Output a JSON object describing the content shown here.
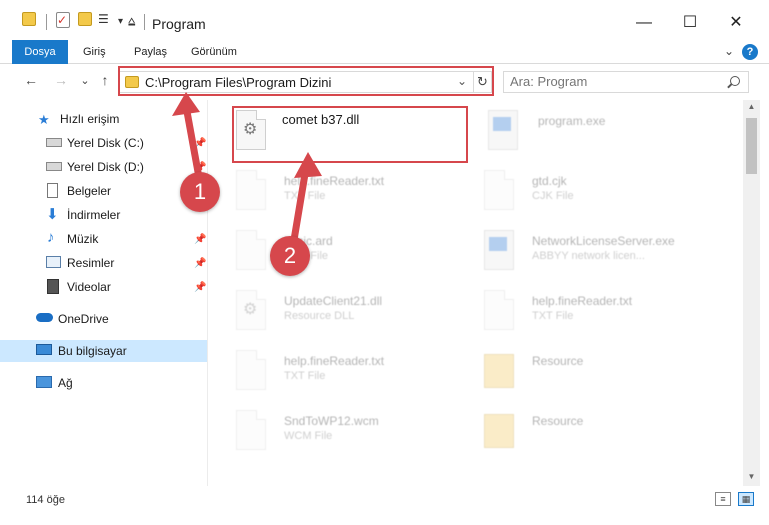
{
  "window": {
    "title": "Program",
    "minimize": "—",
    "maximize": "☐",
    "close": "✕"
  },
  "ribbon": {
    "tabs": [
      {
        "label": "Dosya"
      },
      {
        "label": "Giriş"
      },
      {
        "label": "Paylaş"
      },
      {
        "label": "Görünüm"
      }
    ],
    "expand": "⌄",
    "help": "?"
  },
  "nav": {
    "back": "←",
    "forward": "→",
    "recent": "⌄",
    "up": "↑",
    "address": "C:\\Program Files\\Program Dizini",
    "address_dropdown": "⌄",
    "refresh": "↻",
    "search_placeholder": "Ara: Program"
  },
  "sidebar": {
    "items": [
      {
        "label": "Hızlı erişim",
        "icon": "star-icon"
      },
      {
        "label": "Yerel Disk (C:)",
        "icon": "drive-icon"
      },
      {
        "label": "Yerel Disk (D:)",
        "icon": "drive-icon"
      },
      {
        "label": "Belgeler",
        "icon": "documents-icon"
      },
      {
        "label": "İndirmeler",
        "icon": "download-icon"
      },
      {
        "label": "Müzik",
        "icon": "music-icon"
      },
      {
        "label": "Resimler",
        "icon": "pictures-icon"
      },
      {
        "label": "Videolar",
        "icon": "video-icon"
      },
      {
        "label": "OneDrive",
        "icon": "cloud-icon"
      },
      {
        "label": "Bu bilgisayar",
        "icon": "computer-icon"
      },
      {
        "label": "Ağ",
        "icon": "network-icon"
      }
    ]
  },
  "files": [
    {
      "name": "comet b37.dll",
      "type": ""
    },
    {
      "name": "program.exe",
      "type": ""
    },
    {
      "name": "help.fineReader.txt",
      "type": "TXT File"
    },
    {
      "name": "gtd.cjk",
      "type": "CJK File"
    },
    {
      "name": "basic.ard",
      "type": "ARD File"
    },
    {
      "name": "NetworkLicenseServer.exe",
      "type": "ABBYY network licen..."
    },
    {
      "name": "UpdateClient21.dll",
      "type": "Resource DLL"
    },
    {
      "name": "help.fineReader.txt",
      "type": "TXT File"
    },
    {
      "name": "help.fineReader.txt",
      "type": "TXT File"
    },
    {
      "name": "Resource",
      "type": ""
    },
    {
      "name": "SndToWP12.wcm",
      "type": "WCM File"
    },
    {
      "name": "Resource",
      "type": ""
    }
  ],
  "annotations": {
    "badge1": "1",
    "badge2": "2",
    "color": "#d6474c"
  },
  "status": {
    "count": "114 öğe"
  }
}
